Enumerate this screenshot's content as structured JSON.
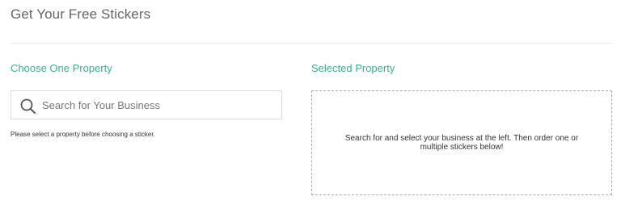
{
  "page": {
    "title": "Get Your Free Stickers"
  },
  "left_panel": {
    "heading": "Choose One Property",
    "search": {
      "placeholder": "Search for Your Business",
      "value": "",
      "icon": "search-icon"
    },
    "help_text": "Please select a property before choosing a sticker."
  },
  "right_panel": {
    "heading": "Selected Property",
    "empty_message": "Search for and select your business at the left. Then order one or multiple stickers below!"
  },
  "colors": {
    "accent": "#3dae8e",
    "title_text": "#666666",
    "border": "#dcdcdc",
    "dashed_border": "#a8a8a8"
  }
}
